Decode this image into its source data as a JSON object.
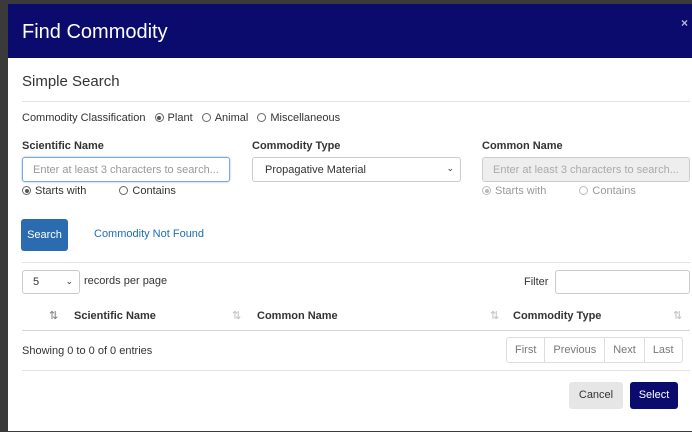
{
  "dialog": {
    "title": "Find Commodity",
    "close_glyph": "×",
    "subtitle": "Simple Search"
  },
  "classification": {
    "label": "Commodity Classification",
    "options": [
      "Plant",
      "Animal",
      "Miscellaneous"
    ],
    "selected": "Plant"
  },
  "scientific_name": {
    "label": "Scientific Name",
    "placeholder": "Enter at least 3 characters to search...",
    "match_options": [
      "Starts with",
      "Contains"
    ],
    "selected": "Starts with"
  },
  "commodity_type": {
    "label": "Commodity Type",
    "value": "Propagative Material"
  },
  "common_name": {
    "label": "Common Name",
    "placeholder": "Enter at least 3 characters to search...",
    "match_options": [
      "Starts with",
      "Contains"
    ],
    "selected": "Starts with"
  },
  "actions": {
    "search_label": "Search",
    "not_found_label": "Commodity Not Found"
  },
  "table": {
    "page_size": "5",
    "page_size_suffix": "records per page",
    "filter_label": "Filter",
    "columns": [
      "Scientific Name",
      "Common Name",
      "Commodity Type"
    ],
    "info": "Showing 0 to 0 of 0 entries",
    "pagination": [
      "First",
      "Previous",
      "Next",
      "Last"
    ]
  },
  "footer": {
    "cancel_label": "Cancel",
    "select_label": "Select"
  },
  "colors": {
    "header": "#0b0b6e",
    "primary_button": "#2b6cb0",
    "link": "#1f6bb8"
  }
}
